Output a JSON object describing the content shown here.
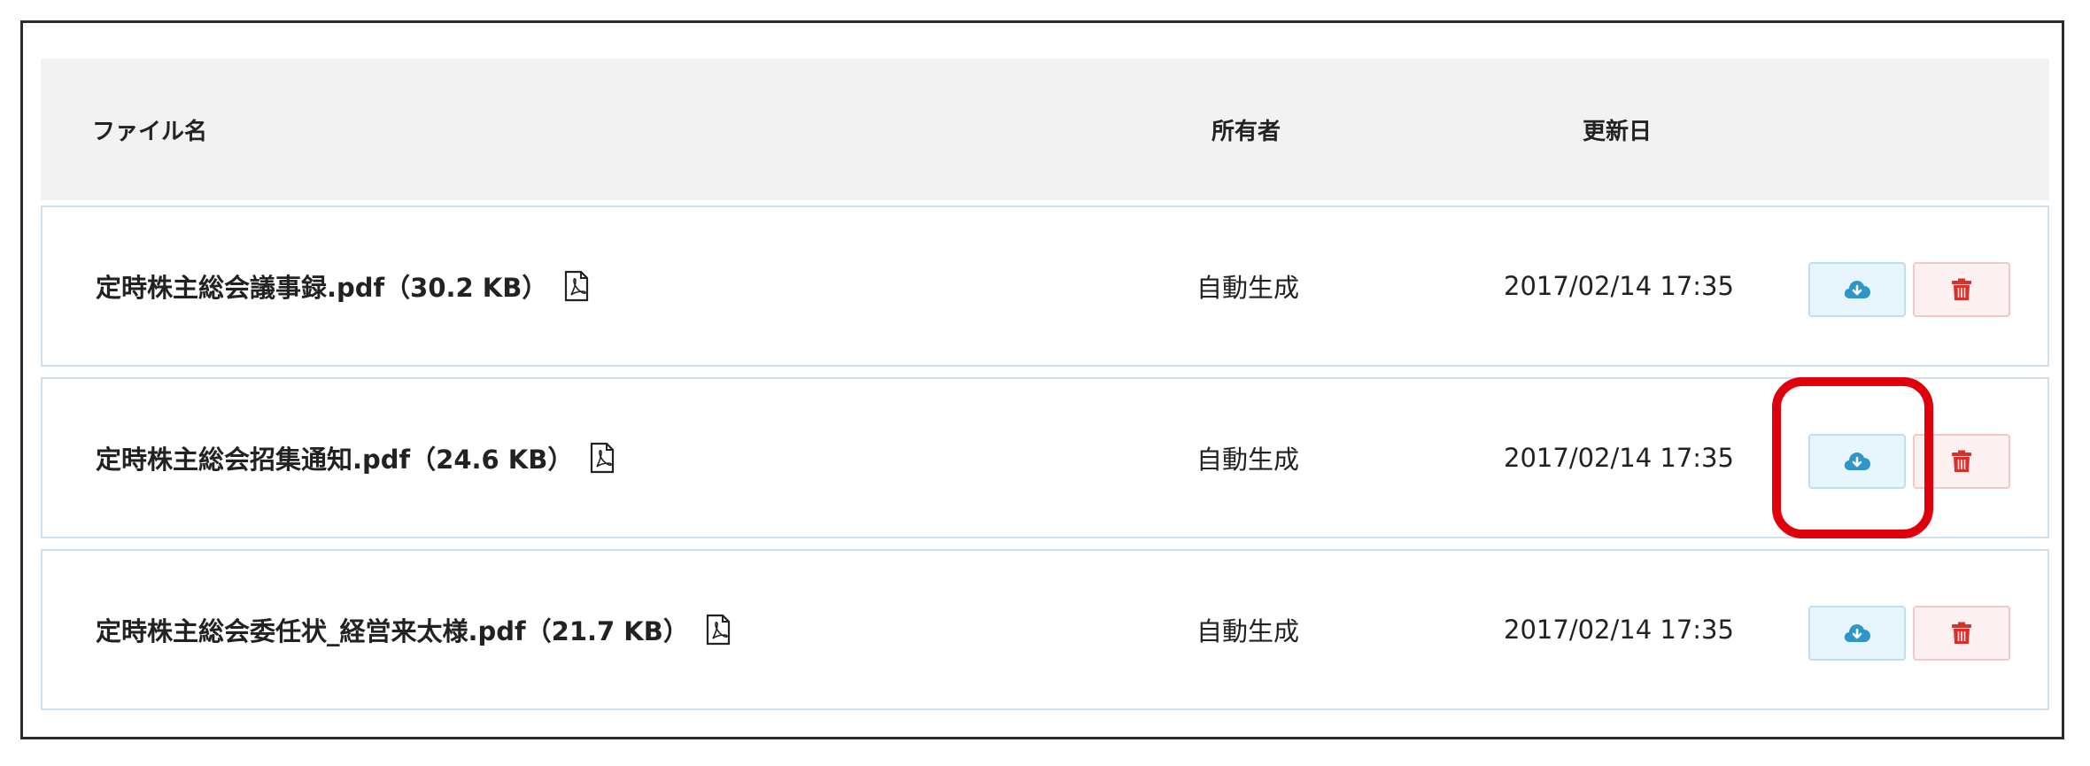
{
  "table": {
    "headers": {
      "file_name": "ファイル名",
      "owner": "所有者",
      "updated": "更新日"
    },
    "rows": [
      {
        "file_name": "定時株主総会議事録.pdf（30.2 KB）",
        "owner": "自動生成",
        "updated": "2017/02/14 17:35"
      },
      {
        "file_name": "定時株主総会招集通知.pdf（24.6 KB）",
        "owner": "自動生成",
        "updated": "2017/02/14 17:35"
      },
      {
        "file_name": "定時株主総会委任状_経営来太様.pdf（21.7 KB）",
        "owner": "自動生成",
        "updated": "2017/02/14 17:35"
      }
    ]
  },
  "icons": {
    "file_type": "pdf-icon",
    "download": "cloud-download-icon",
    "delete": "trash-icon"
  },
  "colors": {
    "download_icon": "#2f96c8",
    "delete_icon": "#d9302c",
    "highlight": "#e0000b",
    "row_border": "#cfe0ec",
    "header_bg": "#f2f2f2"
  }
}
